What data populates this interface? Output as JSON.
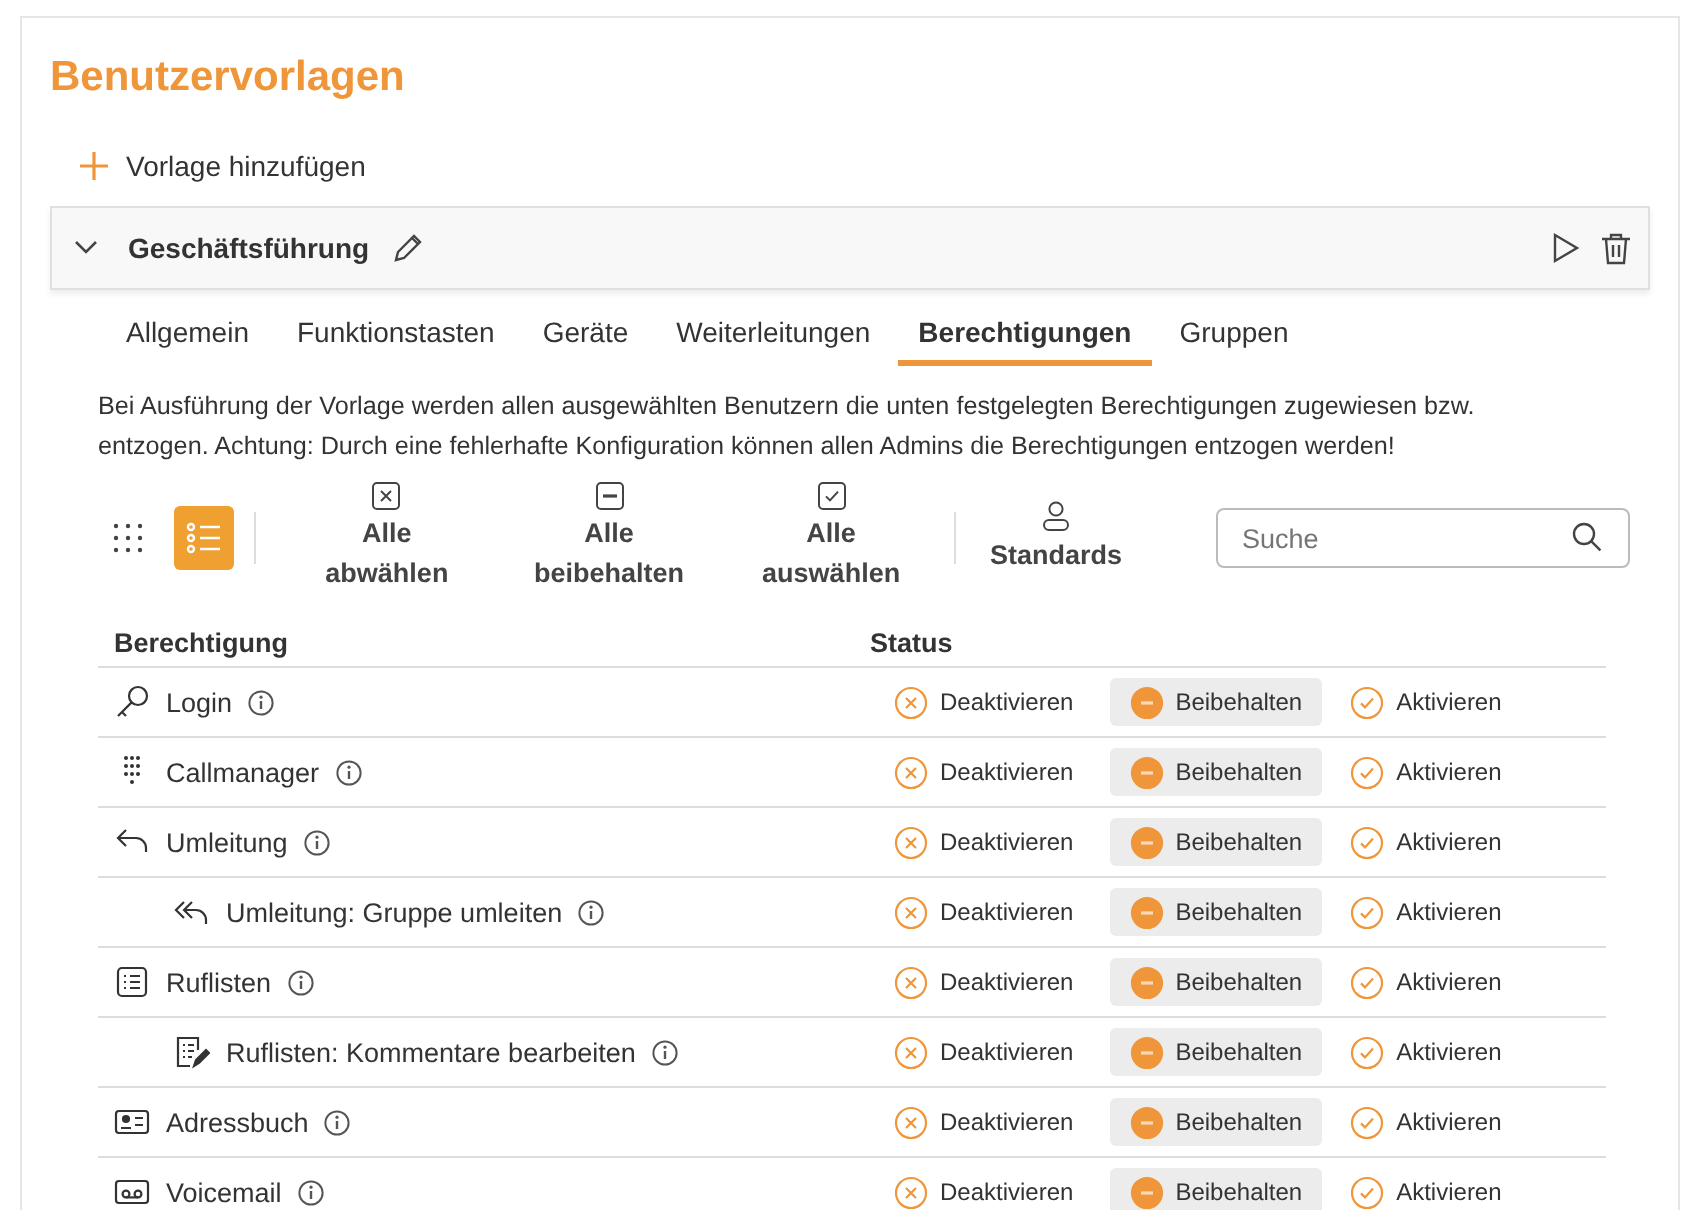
{
  "title": "Benutzervorlagen",
  "add_button": "Vorlage hinzufügen",
  "template": {
    "name": "Geschäftsführung",
    "expanded": true
  },
  "tabs": [
    {
      "label": "Allgemein",
      "selected": false
    },
    {
      "label": "Funktionstasten",
      "selected": false
    },
    {
      "label": "Geräte",
      "selected": false
    },
    {
      "label": "Weiterleitungen",
      "selected": false
    },
    {
      "label": "Berechtigungen",
      "selected": true
    },
    {
      "label": "Gruppen",
      "selected": false
    }
  ],
  "description": "Bei Ausführung der Vorlage werden allen ausgewählten Benutzern die unten festgelegten Berechtigungen zugewiesen bzw. entzogen. Achtung: Durch eine fehlerhafte Konfiguration können allen Admins die Berechtigungen entzogen werden!",
  "view_toggle": [
    {
      "kind": "grid",
      "selected": false
    },
    {
      "kind": "list",
      "selected": true
    }
  ],
  "bulk_actions": [
    {
      "kind": "deactivate",
      "label": "Alle abwählen"
    },
    {
      "kind": "keep",
      "label": "Alle beibehalten"
    },
    {
      "kind": "activate",
      "label": "Alle auswählen"
    }
  ],
  "defaults_button": "Standards",
  "search": {
    "placeholder": "Suche"
  },
  "table": {
    "columns": [
      "Berechtigung",
      "Status"
    ],
    "rows": [
      {
        "kind": "key",
        "name": "Login",
        "options": [
          {
            "kind": "deactivate",
            "label": "Deaktivieren",
            "selected": false
          },
          {
            "kind": "keep",
            "label": "Beibehalten",
            "selected": true
          },
          {
            "kind": "activate",
            "label": "Aktivieren",
            "selected": false
          }
        ]
      },
      {
        "kind": "dialpad",
        "name": "Callmanager",
        "options": [
          {
            "kind": "deactivate",
            "label": "Deaktivieren",
            "selected": false
          },
          {
            "kind": "keep",
            "label": "Beibehalten",
            "selected": true
          },
          {
            "kind": "activate",
            "label": "Aktivieren",
            "selected": false
          }
        ]
      },
      {
        "kind": "reply",
        "name": "Umleitung",
        "options": [
          {
            "kind": "deactivate",
            "label": "Deaktivieren",
            "selected": false
          },
          {
            "kind": "keep",
            "label": "Beibehalten",
            "selected": true
          },
          {
            "kind": "activate",
            "label": "Aktivieren",
            "selected": false
          }
        ],
        "children": [
          {
            "kind": "reply-all",
            "name": "Umleitung: Gruppe umleiten",
            "options": [
              {
                "kind": "deactivate",
                "label": "Deaktivieren",
                "selected": false
              },
              {
                "kind": "keep",
                "label": "Beibehalten",
                "selected": true
              },
              {
                "kind": "activate",
                "label": "Aktivieren",
                "selected": false
              }
            ]
          }
        ]
      },
      {
        "kind": "list",
        "name": "Ruflisten",
        "options": [
          {
            "kind": "deactivate",
            "label": "Deaktivieren",
            "selected": false
          },
          {
            "kind": "keep",
            "label": "Beibehalten",
            "selected": true
          },
          {
            "kind": "activate",
            "label": "Aktivieren",
            "selected": false
          }
        ],
        "children": [
          {
            "kind": "list-edit",
            "name": "Ruflisten: Kommentare bearbeiten",
            "options": [
              {
                "kind": "deactivate",
                "label": "Deaktivieren",
                "selected": false
              },
              {
                "kind": "keep",
                "label": "Beibehalten",
                "selected": true
              },
              {
                "kind": "activate",
                "label": "Aktivieren",
                "selected": false
              }
            ]
          }
        ]
      },
      {
        "kind": "contact",
        "name": "Adressbuch",
        "options": [
          {
            "kind": "deactivate",
            "label": "Deaktivieren",
            "selected": false
          },
          {
            "kind": "keep",
            "label": "Beibehalten",
            "selected": true
          },
          {
            "kind": "activate",
            "label": "Aktivieren",
            "selected": false
          }
        ]
      },
      {
        "kind": "voicemail",
        "name": "Voicemail",
        "options": [
          {
            "kind": "deactivate",
            "label": "Deaktivieren",
            "selected": false
          },
          {
            "kind": "keep",
            "label": "Beibehalten",
            "selected": true
          },
          {
            "kind": "activate",
            "label": "Aktivieren",
            "selected": false
          }
        ]
      }
    ]
  }
}
